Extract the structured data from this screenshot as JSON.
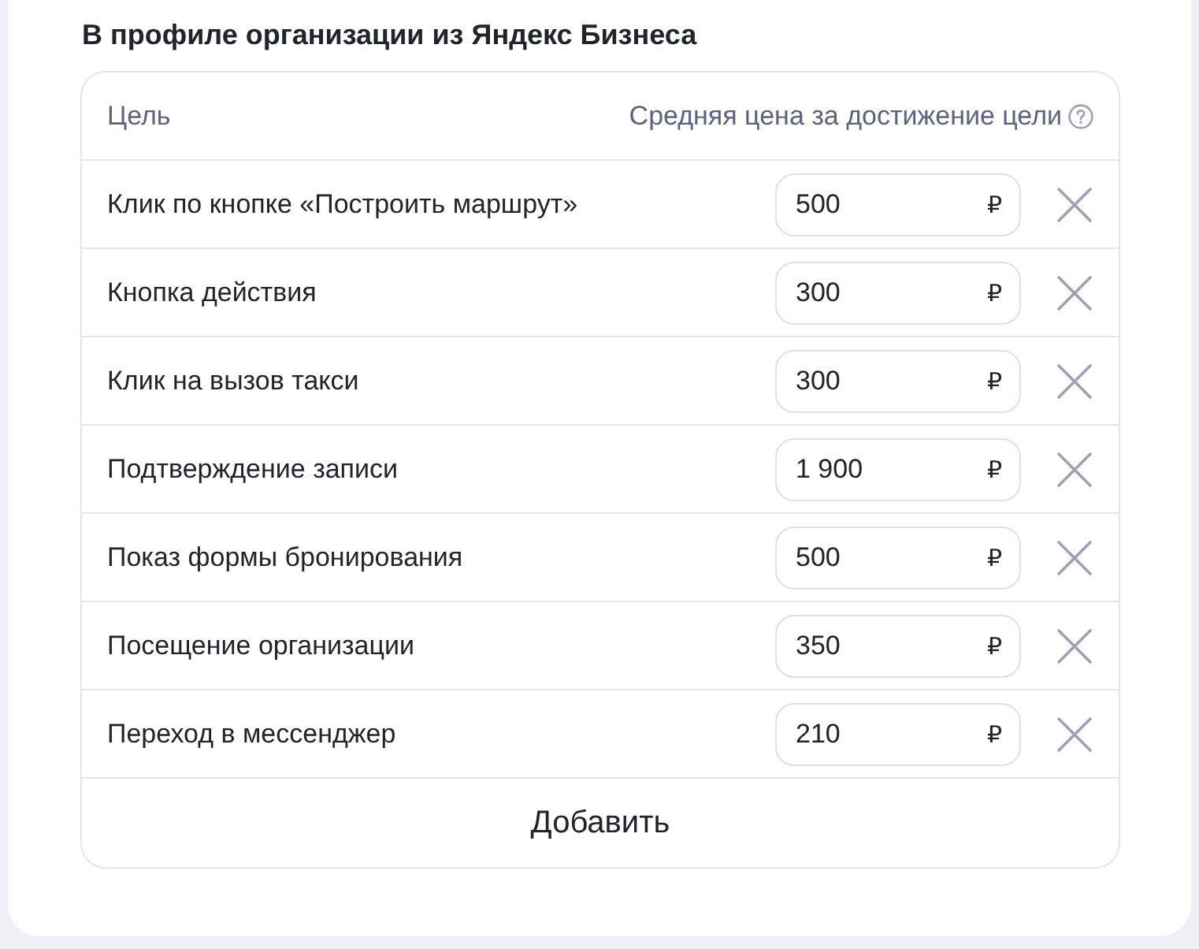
{
  "title": "В профиле организации из Яндекс Бизнеса",
  "table": {
    "columns": [
      "Цель",
      "Средняя цена за достижение цели"
    ],
    "rows": [
      {
        "goal": "Клик по кнопке «Построить маршрут»",
        "price": "500",
        "currency": "₽"
      },
      {
        "goal": "Кнопка действия",
        "price": "300",
        "currency": "₽"
      },
      {
        "goal": "Клик на вызов такси",
        "price": "300",
        "currency": "₽"
      },
      {
        "goal": "Подтверждение записи",
        "price": "1 900",
        "currency": "₽"
      },
      {
        "goal": "Показ формы бронирования",
        "price": "500",
        "currency": "₽"
      },
      {
        "goal": "Посещение организации",
        "price": "350",
        "currency": "₽"
      },
      {
        "goal": "Переход в мессенджер",
        "price": "210",
        "currency": "₽"
      }
    ],
    "add_button": "Добавить"
  }
}
